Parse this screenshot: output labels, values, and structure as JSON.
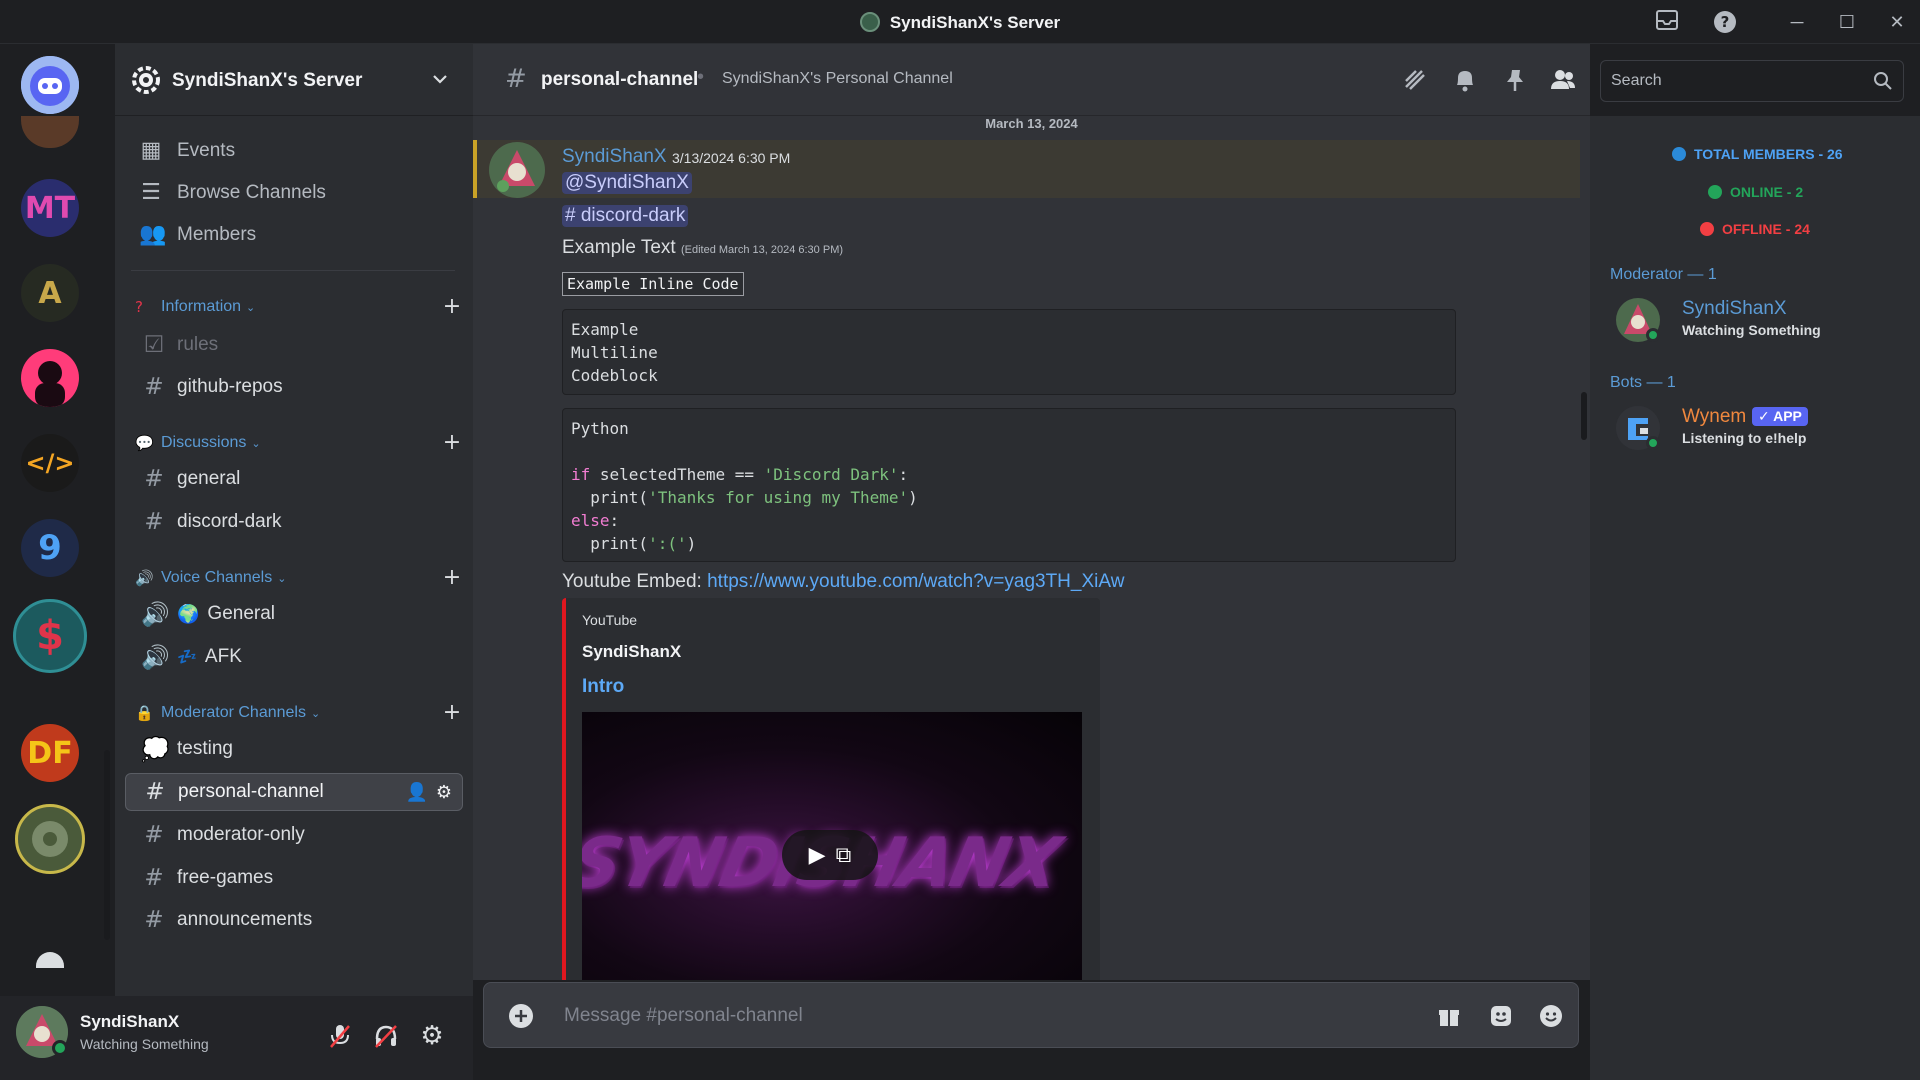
{
  "window": {
    "title": "SyndiShanX's Server"
  },
  "server": {
    "name": "SyndiShanX's Server"
  },
  "nav": {
    "events": "Events",
    "browse": "Browse Channels",
    "members": "Members"
  },
  "categories": {
    "information": {
      "label": "Information",
      "channels": [
        "rules",
        "github-repos"
      ]
    },
    "discussions": {
      "label": "Discussions",
      "channels": [
        "general",
        "discord-dark"
      ]
    },
    "voice": {
      "label": "Voice Channels",
      "channels": [
        "General",
        "AFK"
      ]
    },
    "moderator": {
      "label": "Moderator Channels",
      "channels": [
        "testing",
        "personal-channel",
        "moderator-only",
        "free-games",
        "announcements"
      ]
    }
  },
  "channel": {
    "name": "personal-channel",
    "topic": "SyndiShanX's Personal Channel"
  },
  "search": {
    "placeholder": "Search"
  },
  "date_divider": "March 13, 2024",
  "message": {
    "author": "SyndiShanX",
    "timestamp": "3/13/2024 6:30 PM",
    "mention_user": "@SyndiShanX",
    "mention_channel": "# discord-dark",
    "text": "Example Text",
    "edited": "(Edited March 13, 2024 6:30 PM)",
    "inline_code": "Example Inline Code",
    "codeblock1": [
      "Example",
      "Multiline",
      "Codeblock"
    ],
    "codeblock2": {
      "lang": "Python",
      "l1_kw": "if",
      "l1_var": " selectedTheme == ",
      "l1_str": "'Discord Dark'",
      "l1_end": ":",
      "l2_fn": "  print(",
      "l2_str": "'Thanks for using my Theme'",
      "l2_end": ")",
      "l3_kw": "else",
      "l3_end": ":",
      "l4_fn": "  print(",
      "l4_str": "':('",
      "l4_end": ")"
    },
    "embed_label": "Youtube Embed:",
    "embed_url": "https://www.youtube.com/watch?v=yag3TH_XiAw",
    "embed": {
      "provider": "YouTube",
      "author": "SyndiShanX",
      "title": "Intro",
      "thumb_text": "SYNDISHANX"
    }
  },
  "composer": {
    "placeholder": "Message #personal-channel"
  },
  "member_list": {
    "total": "TOTAL MEMBERS - 26",
    "online": "ONLINE - 2",
    "offline": "OFFLINE - 24",
    "moderator_group": "Moderator — 1",
    "bots_group": "Bots — 1",
    "moderator": {
      "name": "SyndiShanX",
      "status": "Watching Something"
    },
    "bot": {
      "name": "Wynem",
      "badge": "✓ APP",
      "status": "Listening to e!help"
    }
  },
  "user_panel": {
    "name": "SyndiShanX",
    "status": "Watching Something"
  },
  "servers": [
    "MT",
    "A",
    "</>",
    "9",
    "$",
    "DF"
  ],
  "colors": {
    "accent": "#5b9bd5",
    "online": "#23a55a",
    "offline": "#f23f43",
    "total": "#2b8ad8",
    "bot_name": "#f0883e",
    "embed_bar": "#e0171f"
  }
}
